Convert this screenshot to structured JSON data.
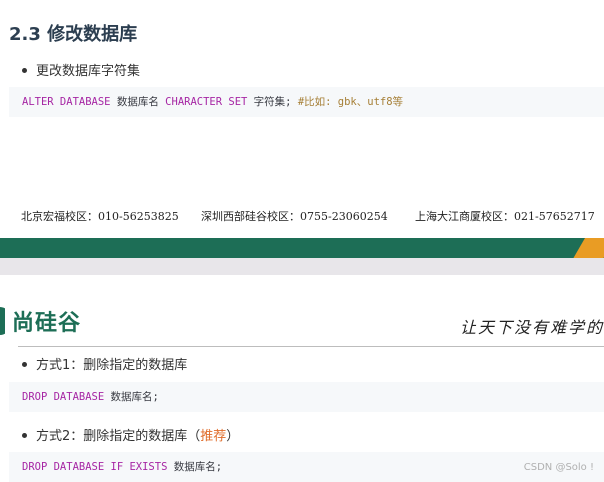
{
  "section": {
    "heading": "2.3 修改数据库",
    "bullet1": "更改数据库字符集",
    "code1": {
      "kw1": "ALTER DATABASE",
      "p1": " 数据库名 ",
      "kw2": "CHARACTER SET",
      "p2": " 字符集;  ",
      "comment": "#比如: gbk、utf8等"
    }
  },
  "footer_addresses": [
    "北京宏福校区：010-56253825",
    "深圳西部硅谷校区：0755-23060254",
    "上海大江商厦校区：021-57652717"
  ],
  "brand": {
    "logo_text": "尚硅谷",
    "slogan": "让天下没有难学的",
    "colors": {
      "green": "#1d6e56",
      "orange": "#e99c24"
    }
  },
  "drop_section": {
    "bullet1": "方式1：删除指定的数据库",
    "code1": {
      "kw": "DROP DATABASE",
      "p": " 数据库名;"
    },
    "bullet2_prefix": "方式2：删除指定的数据库（",
    "bullet2_rec": "推荐",
    "bullet2_suffix": "）",
    "code2": {
      "kw": "DROP DATABASE IF EXISTS",
      "p": " 数据库名;"
    }
  },
  "watermark": "CSDN @Solo !"
}
